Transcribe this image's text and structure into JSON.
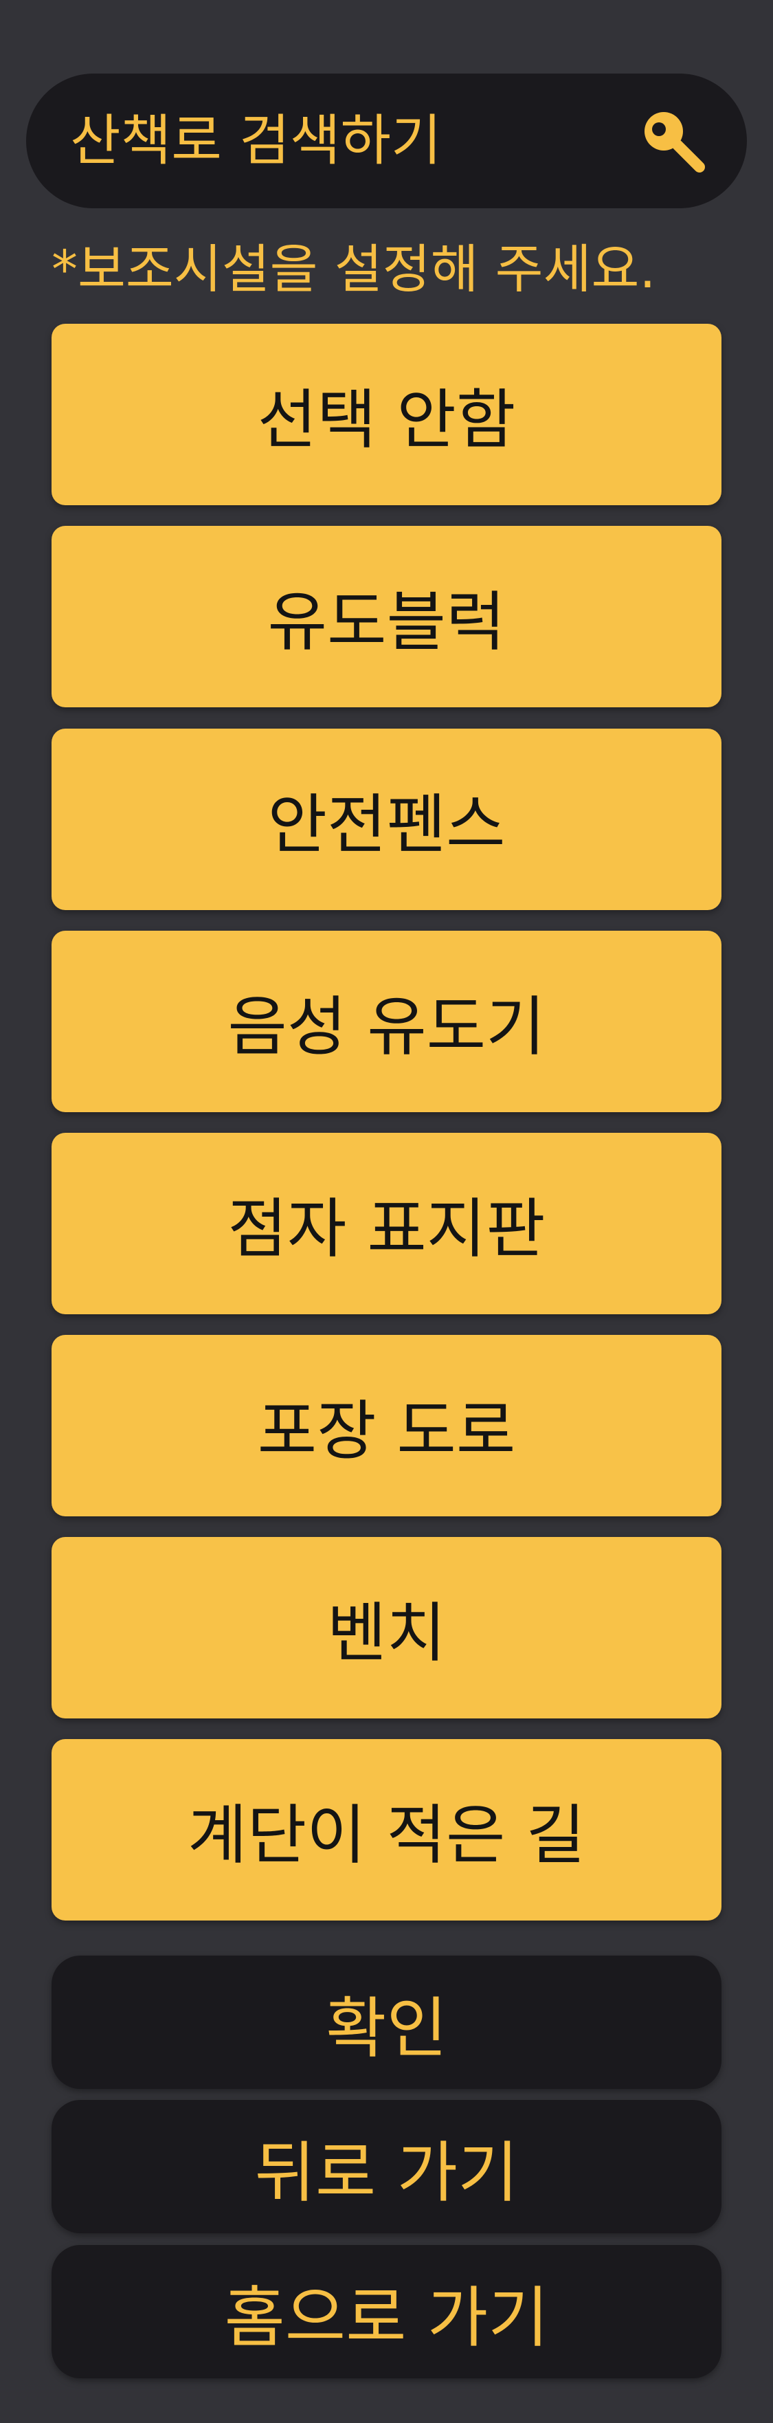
{
  "search": {
    "label": "산책로 검색하기",
    "icon": "search-icon"
  },
  "hint": "*보조시설을 설정해 주세요.",
  "options": [
    {
      "label": "선택 안함"
    },
    {
      "label": "유도블럭"
    },
    {
      "label": "안전펜스"
    },
    {
      "label": "음성 유도기"
    },
    {
      "label": "점자 표지판"
    },
    {
      "label": "포장 도로"
    },
    {
      "label": "벤치"
    },
    {
      "label": "계단이 적은 길"
    }
  ],
  "actions": {
    "confirm": "확인",
    "back": "뒤로 가기",
    "home": "홈으로 가기"
  },
  "colors": {
    "background": "#333338",
    "accent": "#f7bf44",
    "dark": "#1a191d"
  }
}
